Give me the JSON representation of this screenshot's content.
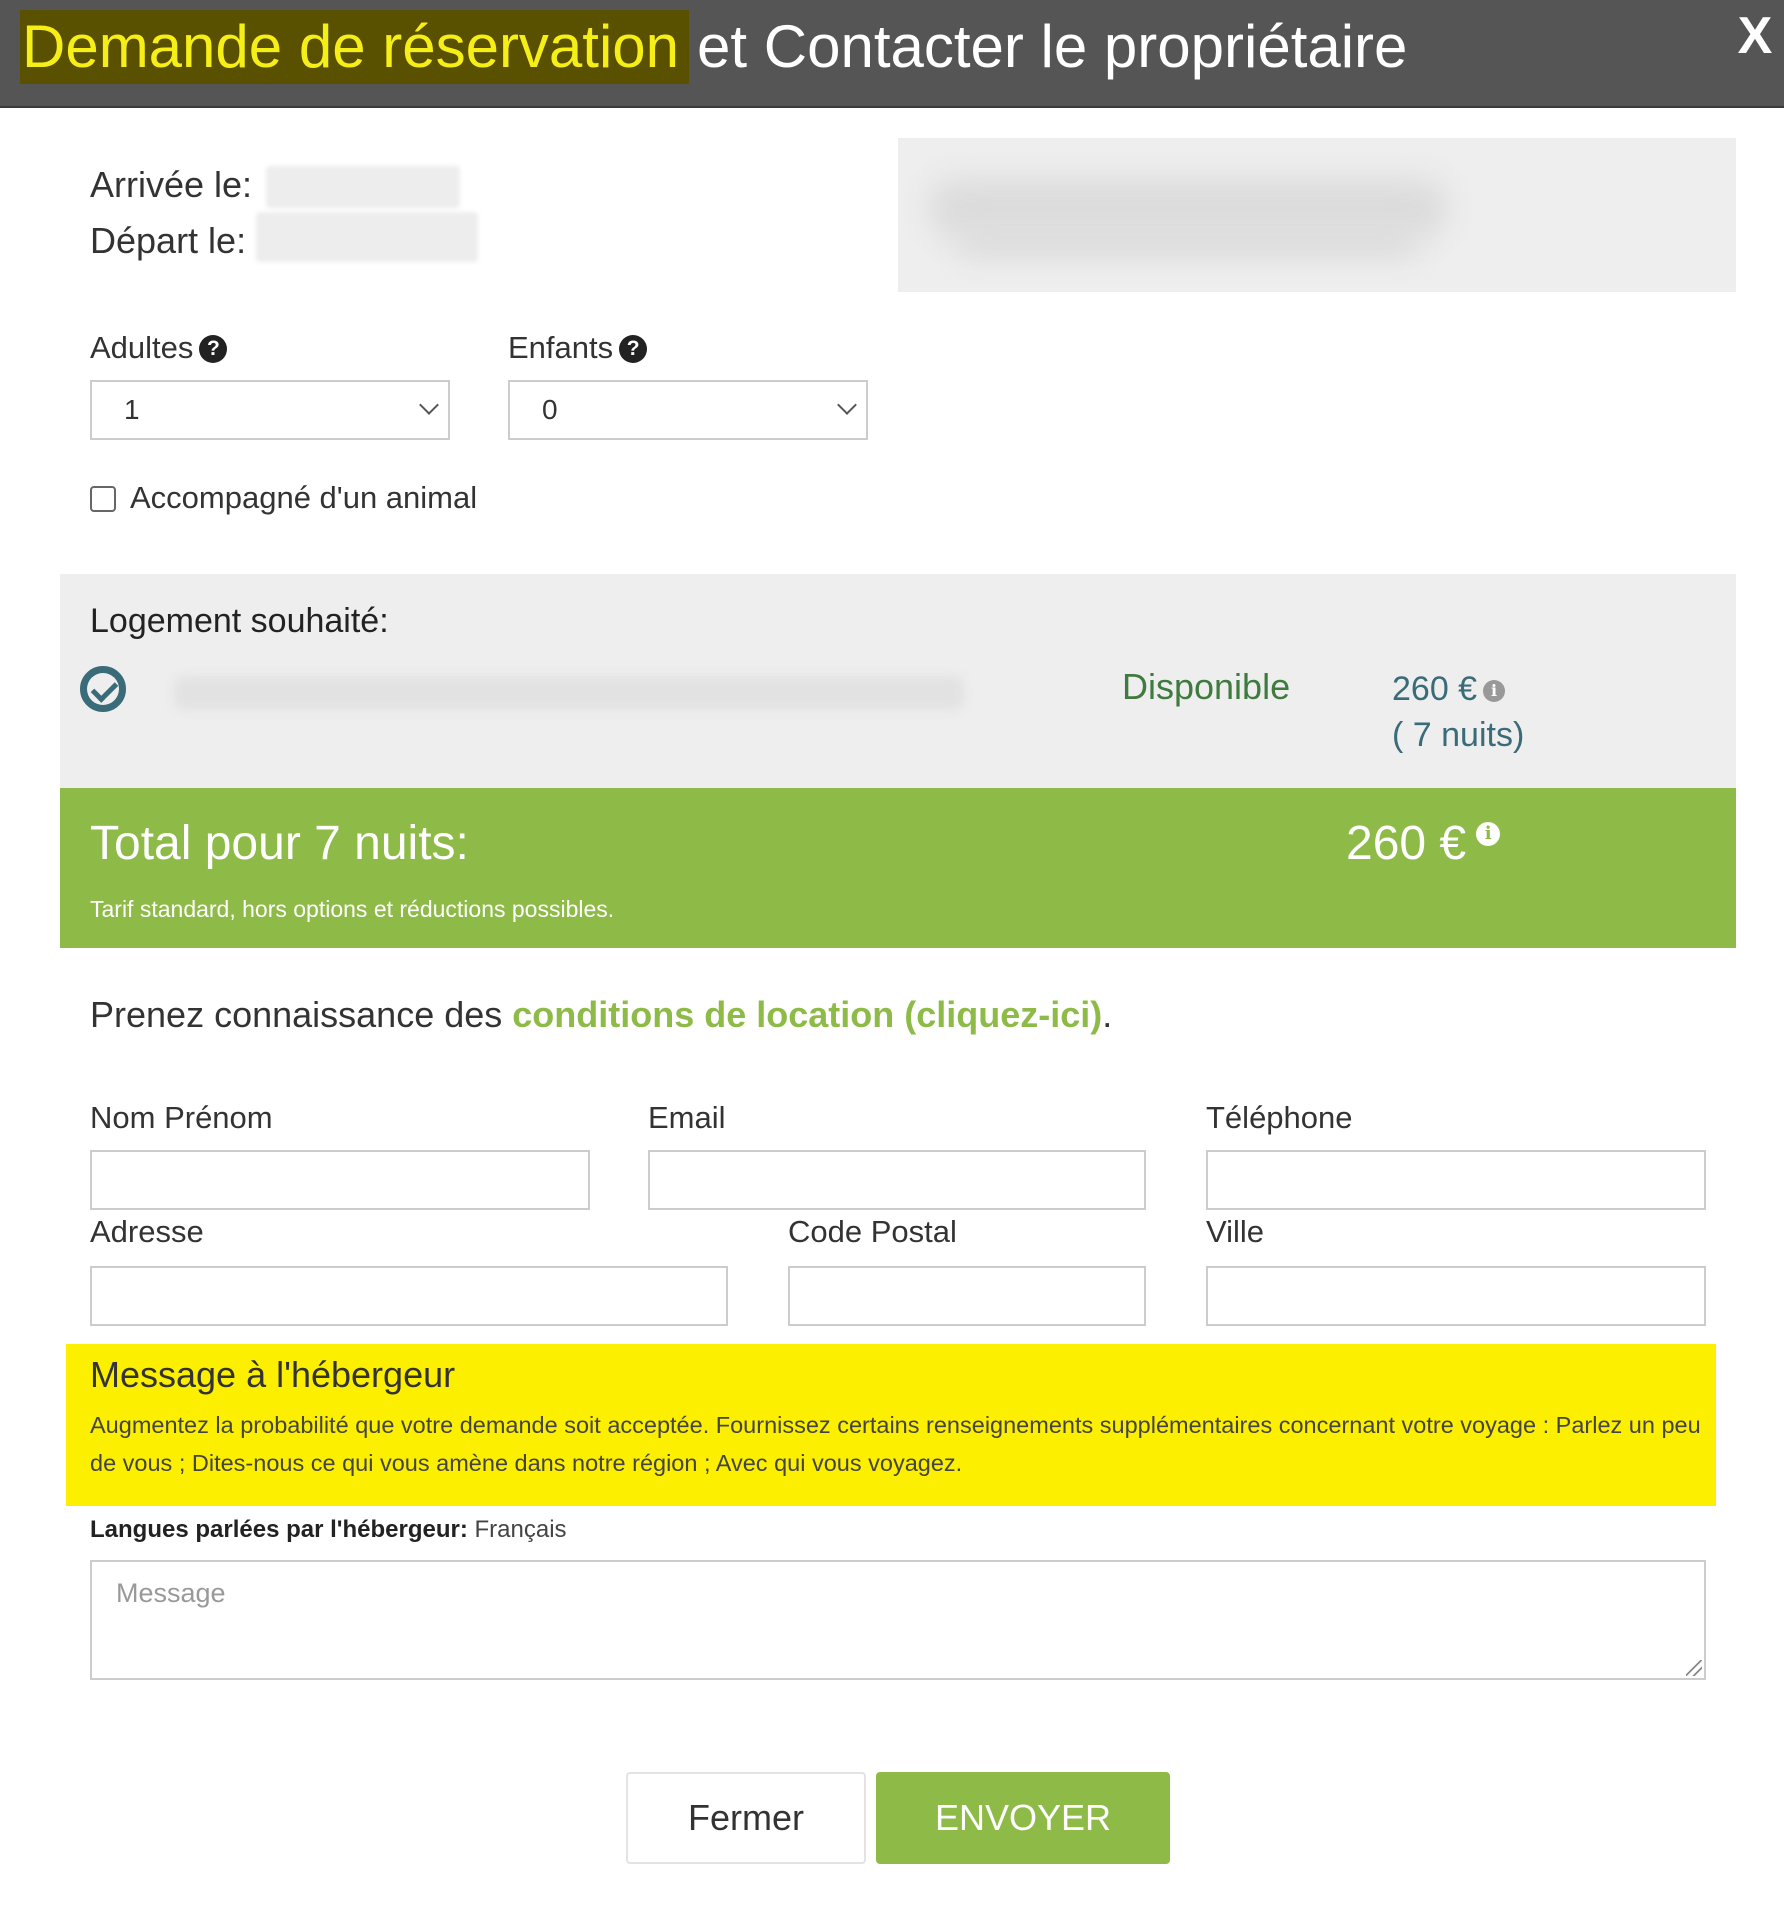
{
  "header": {
    "title_highlight": "Demande de réservation",
    "title_rest": "et Contacter le propriétaire",
    "close_label": "X"
  },
  "dates": {
    "arrival_label": "Arrivée le:",
    "departure_label": "Départ le:"
  },
  "guests": {
    "adults_label": "Adultes",
    "adults_value": "1",
    "children_label": "Enfants",
    "children_value": "0",
    "help_icon": "question-circle-icon",
    "pet_label": "Accompagné d'un animal",
    "pet_checked": false
  },
  "lodging": {
    "title": "Logement souhaité:",
    "availability": "Disponible",
    "price": "260 €",
    "nights": "( 7 nuits)",
    "status_icon": "check-circle-icon"
  },
  "total": {
    "label": "Total pour 7 nuits:",
    "value": "260 €",
    "note": "Tarif standard, hors options et réductions possibles."
  },
  "conditions": {
    "prefix": "Prenez connaissance des ",
    "link": "conditions de location (cliquez-ici)",
    "suffix": "."
  },
  "form": {
    "name_label": "Nom Prénom",
    "email_label": "Email",
    "phone_label": "Téléphone",
    "address_label": "Adresse",
    "postal_label": "Code Postal",
    "city_label": "Ville"
  },
  "message": {
    "title": "Message à l'hébergeur",
    "text": "Augmentez la probabilité que votre demande soit acceptée. Fournissez certains renseignements supplémentaires concernant votre voyage : Parlez un peu de vous ; Dites-nous ce qui vous amène dans notre région ; Avec qui vous voyagez.",
    "languages_label": "Langues parlées par l'hébergeur:",
    "languages_value": " Français",
    "placeholder": "Message"
  },
  "buttons": {
    "close": "Fermer",
    "send": "ENVOYER"
  },
  "colors": {
    "header_bg": "#555555",
    "title_highlight_bg": "#5a5100",
    "title_highlight_text": "#f6ef17",
    "accent_green": "#8ebb47",
    "availability_green": "#3f7a3f",
    "price_teal": "#3a6b78",
    "message_yellow": "#fcef00"
  }
}
